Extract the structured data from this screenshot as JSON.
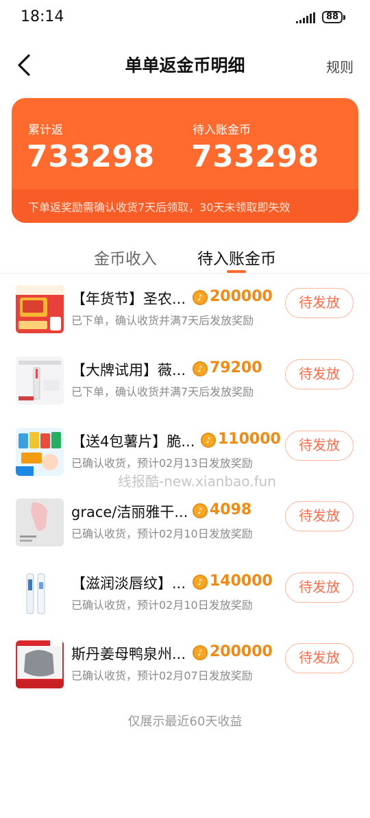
{
  "status_bar": {
    "time": "18:14",
    "battery": "88"
  },
  "header": {
    "title": "单单返金币明细",
    "rules_label": "规则"
  },
  "summary": {
    "total_label": "累计返",
    "total_value": "733298",
    "pending_label": "待入账金币",
    "pending_value": "733298",
    "note": "下单返奖励需确认收货7天后领取，30天未领取即失效",
    "color": "#ff6a2e"
  },
  "tabs": [
    {
      "label": "金币收入",
      "active": false
    },
    {
      "label": "待入账金币",
      "active": true
    }
  ],
  "items": [
    {
      "name": "【年货节】圣农...",
      "amount": "200000",
      "status": "已下单，确认收货并满7天后发放奖励",
      "button": "待发放"
    },
    {
      "name": "【大牌试用】薇...",
      "amount": "79200",
      "status": "已下单，确认收货并满7天后发放奖励",
      "button": "待发放"
    },
    {
      "name": "【送4包薯片】脆...",
      "amount": "110000",
      "status": "已确认收货，预计02月13日发放奖励",
      "button": "待发放"
    },
    {
      "name": "grace/洁丽雅干...",
      "amount": "4098",
      "status": "已确认收货，预计02月10日发放奖励",
      "button": "待发放"
    },
    {
      "name": "【滋润淡唇纹】...",
      "amount": "140000",
      "status": "已确认收货，预计02月10日发放奖励",
      "button": "待发放"
    },
    {
      "name": "斯丹姜母鸭泉州...",
      "amount": "200000",
      "status": "已确认收货，预计02月07日发放奖励",
      "button": "待发放"
    }
  ],
  "watermark": "线报酷-new.xianbao.fun",
  "footer": "仅展示最近60天收益",
  "colors": {
    "accent": "#ff6a2e",
    "amount": "#f08a14",
    "button_text": "#ff6a4a"
  }
}
